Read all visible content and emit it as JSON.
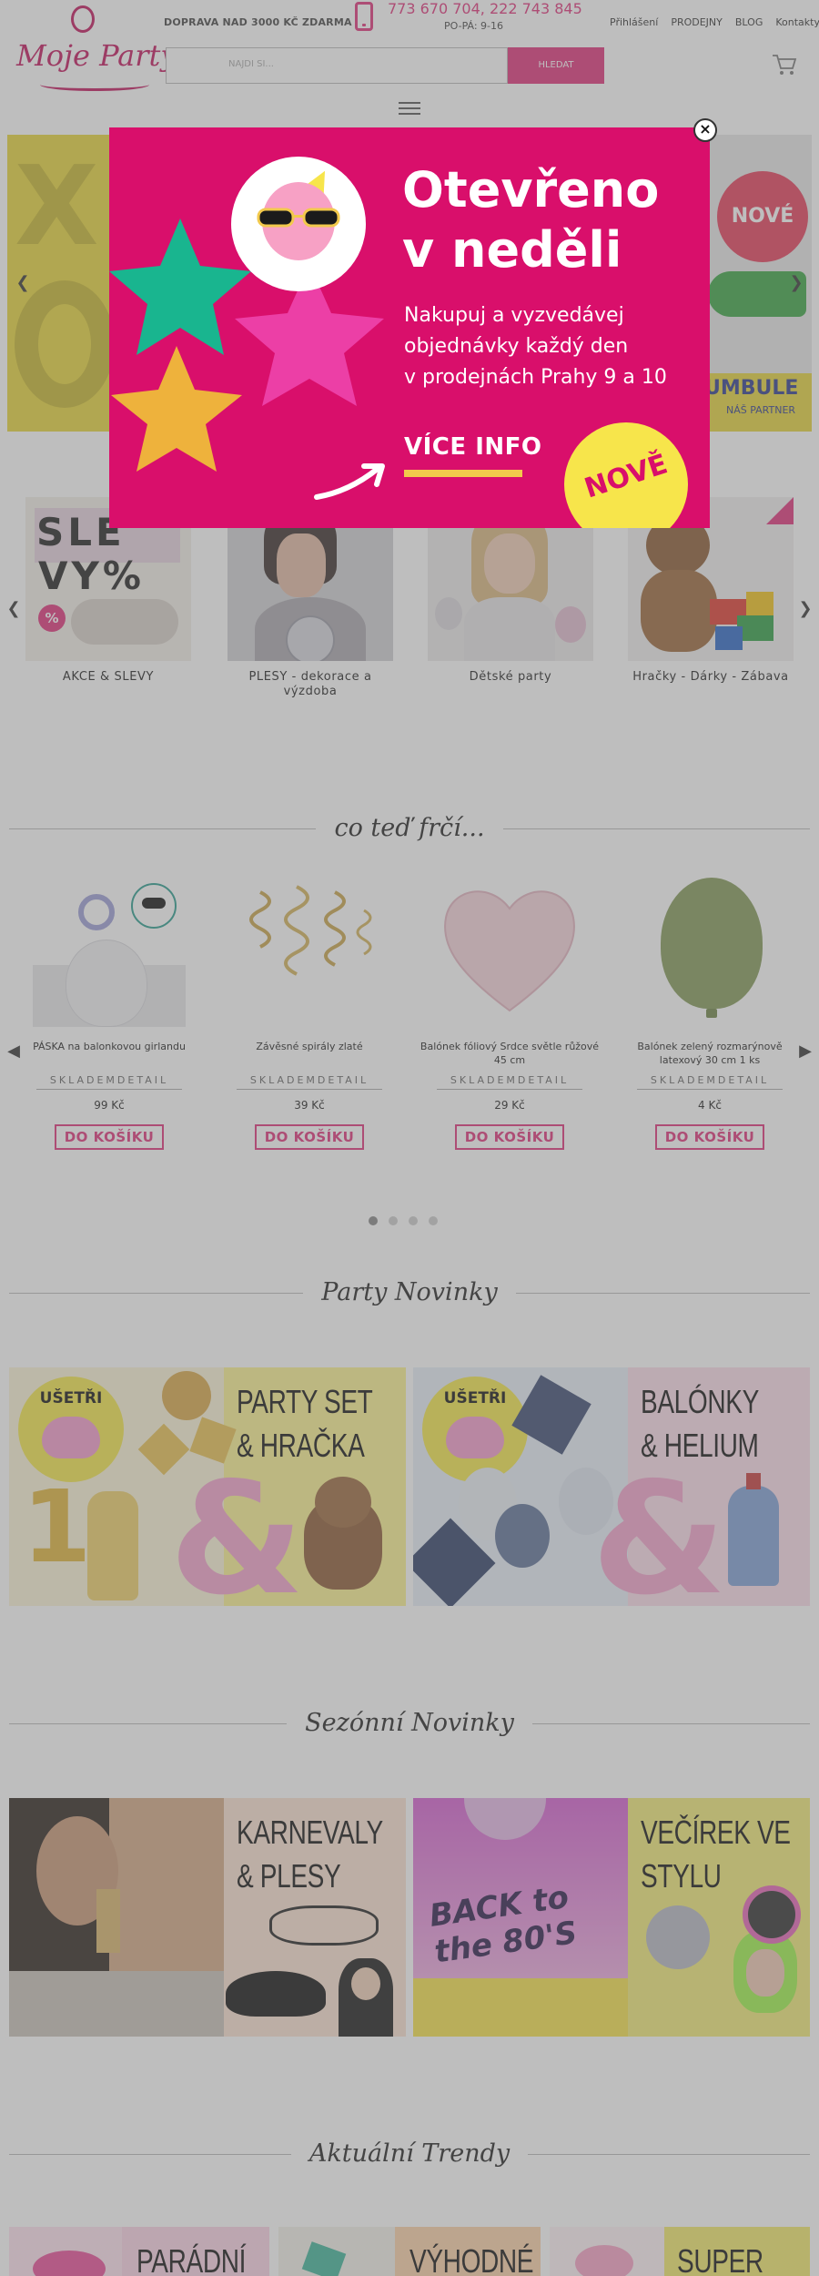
{
  "header": {
    "logo": "Moje Party",
    "shipping": "DOPRAVA NAD 3000 KČ ZDARMA",
    "phone": "773 670 704, 222 743 845",
    "hours": "PO-PÁ: 9-16",
    "links": [
      "Přihlášení",
      "PRODEJNY",
      "BLOG",
      "Kontakty"
    ],
    "search_placeholder": "NAJDI SI...",
    "search_button": "HLEDAT"
  },
  "hero": {
    "right_badge": "NOVÉ",
    "right_tag_big": "UMBULE",
    "right_tag_small": "NÁŠ PARTNER"
  },
  "categories": [
    {
      "label": "AKCE & SLEVY"
    },
    {
      "label": "PLESY - dekorace a výzdoba"
    },
    {
      "label": "Dětské party"
    },
    {
      "label": "Hračky - Dárky - Zábava"
    }
  ],
  "sections": {
    "trending": "co teď frčí...",
    "party_news": "Party Novinky",
    "season_news": "Sezónní Novinky",
    "trends": "Aktuální Trendy"
  },
  "products": [
    {
      "name": "PÁSKA na balonkovou girlandu",
      "stock": "SKLADEM",
      "detail": "DETAIL",
      "price": "99 Kč",
      "button": "DO KOŠÍKU"
    },
    {
      "name": "Závěsné spirály zlaté",
      "stock": "SKLADEM",
      "detail": "DETAIL",
      "price": "39 Kč",
      "button": "DO KOŠÍKU"
    },
    {
      "name": "Balónek fóliový Srdce světle růžové 45 cm",
      "stock": "SKLADEM",
      "detail": "DETAIL",
      "price": "29 Kč",
      "button": "DO KOŠÍKU"
    },
    {
      "name": "Balónek zelený rozmarýnově latexový 30 cm 1 ks",
      "stock": "SKLADEM",
      "detail": "DETAIL",
      "price": "4 Kč",
      "button": "DO KOŠÍKU"
    }
  ],
  "party_banners": [
    {
      "badge": "UŠETŘI",
      "title_1": "PARTY SET",
      "title_2": "& HRAČKA",
      "amp": "&"
    },
    {
      "badge": "UŠETŘI",
      "title_1": "BALÓNKY",
      "title_2": "& HELIUM",
      "amp": "&"
    }
  ],
  "season_banners": [
    {
      "title_1": "KARNEVALY",
      "title_2": "& PLESY"
    },
    {
      "title_1": "VEČÍREK VE",
      "title_2": "STYLU",
      "art": "BACK to the 80'S"
    }
  ],
  "trend_banners": [
    {
      "title": "PARÁDNÍ"
    },
    {
      "title": "VÝHODNÉ"
    },
    {
      "title": "SUPER"
    }
  ],
  "modal": {
    "headline_1": "Otevřeno",
    "headline_2": "v neděli",
    "text_1": "Nakupuj a vyzvedávej",
    "text_2": "objednávky každý den",
    "text_3": "v prodejnách Prahy 9 a 10",
    "cta": "VÍCE INFO",
    "badge": "NOVĚ",
    "close": "×"
  },
  "colors": {
    "brand_pink": "#e0327a",
    "modal_bg": "#d90f6b",
    "badge_yellow": "#f7e54b"
  }
}
